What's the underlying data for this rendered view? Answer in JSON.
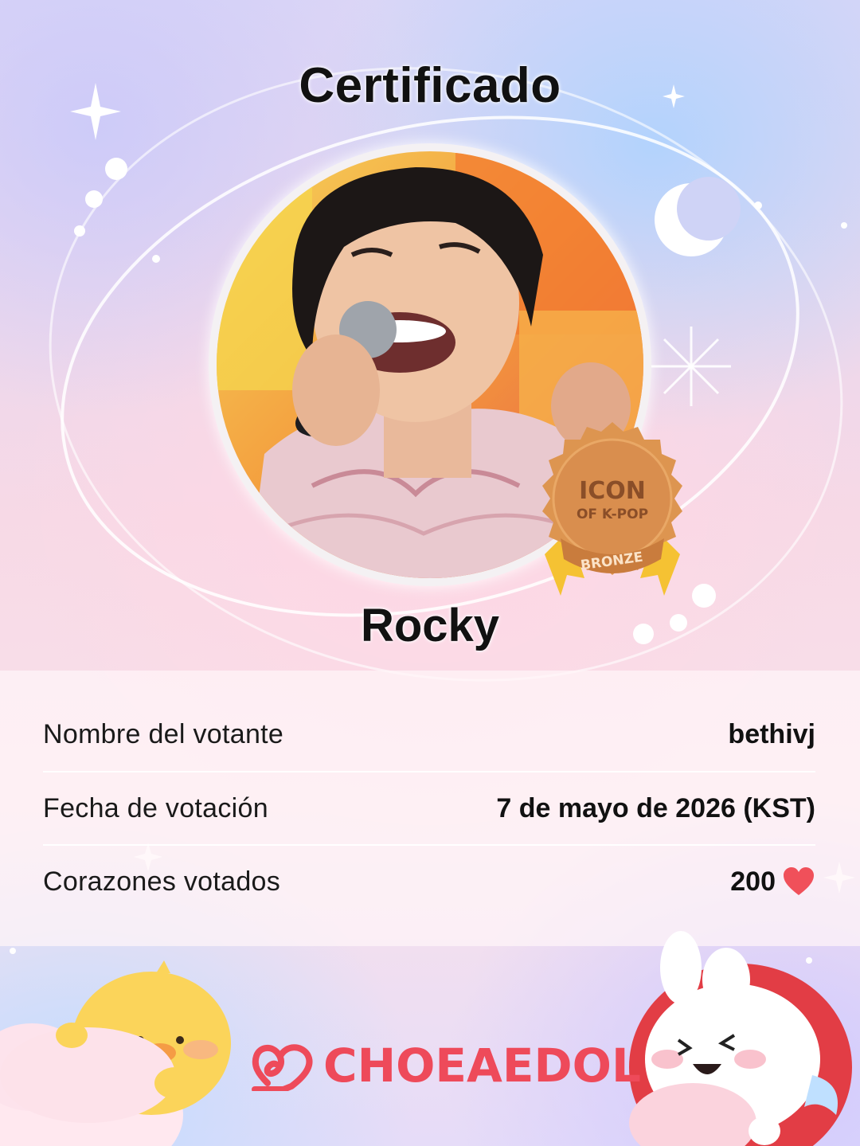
{
  "certificate": {
    "title": "Certificado",
    "idol_name": "Rocky",
    "badge": {
      "line1": "ICON",
      "line2": "OF K-POP",
      "tier": "BRONZE"
    }
  },
  "details": [
    {
      "label": "Nombre del votante",
      "value": "bethivj"
    },
    {
      "label": "Fecha de votación",
      "value": "7 de mayo de 2026 (KST)"
    },
    {
      "label": "Corazones votados",
      "value": "200"
    }
  ],
  "footer": {
    "brand": "CHOEAEDOL"
  },
  "colors": {
    "brand_red": "#ee4a5a",
    "heart": "#f0505a",
    "badge_bronze": "#d98e4e",
    "ribbon_yellow": "#f5c233"
  },
  "icons": {
    "heart": "heart-icon",
    "logo": "choeaedol-logo-icon"
  }
}
